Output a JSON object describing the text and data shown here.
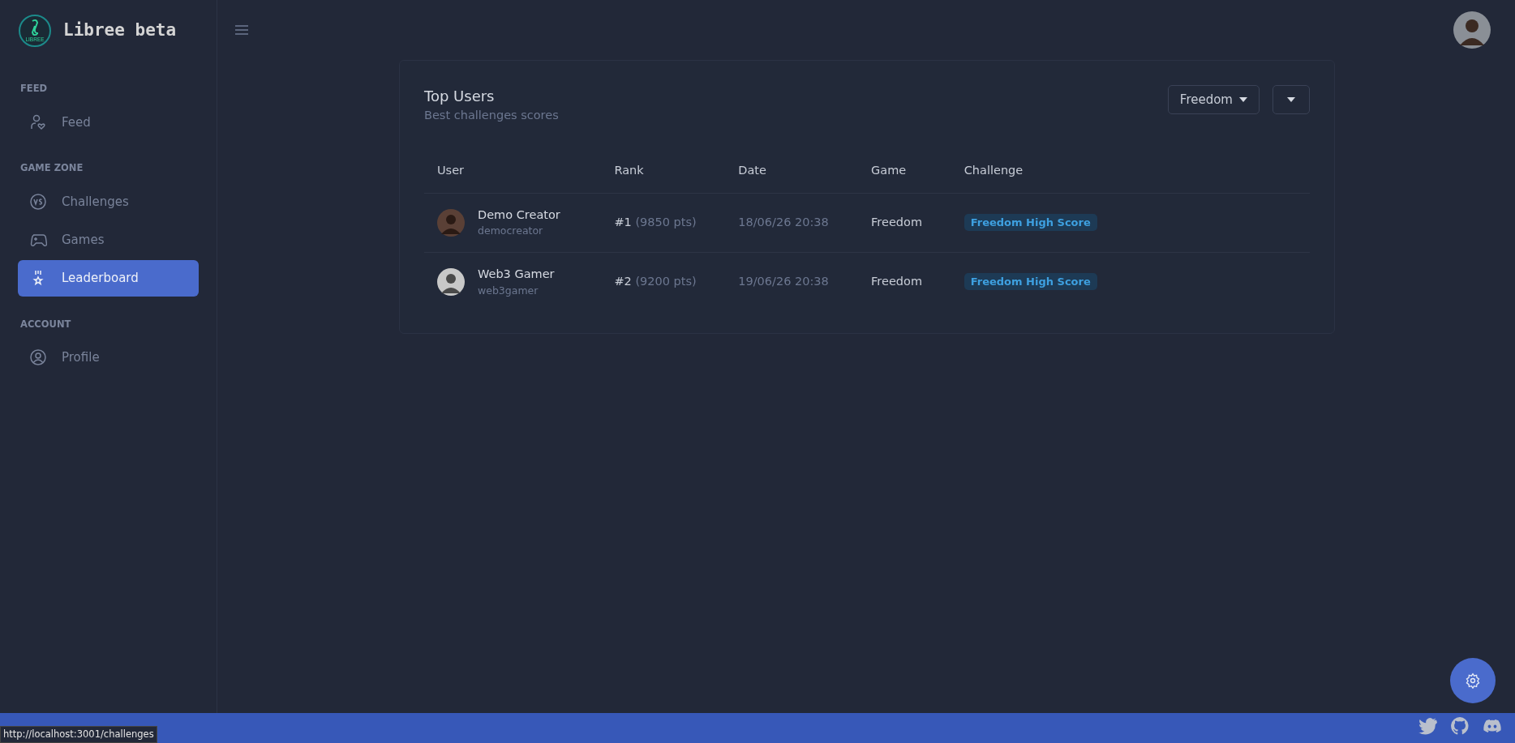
{
  "brand": {
    "logo_text": "LIBREE",
    "title": "Libree beta"
  },
  "sidebar": {
    "sections": [
      {
        "heading": "FEED",
        "items": [
          {
            "label": "Feed",
            "selected": false
          }
        ]
      },
      {
        "heading": "GAME ZONE",
        "items": [
          {
            "label": "Challenges",
            "selected": false
          },
          {
            "label": "Games",
            "selected": false
          },
          {
            "label": "Leaderboard",
            "selected": true
          }
        ]
      },
      {
        "heading": "ACCOUNT",
        "items": [
          {
            "label": "Profile",
            "selected": false
          }
        ]
      }
    ]
  },
  "card": {
    "title": "Top Users",
    "subtitle": "Best challenges scores",
    "filter": "Freedom",
    "table": {
      "columns": [
        "User",
        "Rank",
        "Date",
        "Game",
        "Challenge"
      ],
      "rows": [
        {
          "name": "Demo Creator",
          "handle": "democreator",
          "rank": "#1",
          "points": "(9850 pts)",
          "date": "18/06/26 20:38",
          "game": "Freedom",
          "challenge": "Freedom High Score"
        },
        {
          "name": "Web3 Gamer",
          "handle": "web3gamer",
          "rank": "#2",
          "points": "(9200 pts)",
          "date": "19/06/26 20:38",
          "game": "Freedom",
          "challenge": "Freedom High Score"
        }
      ]
    }
  },
  "status_tooltip": "http://localhost:3001/challenges"
}
